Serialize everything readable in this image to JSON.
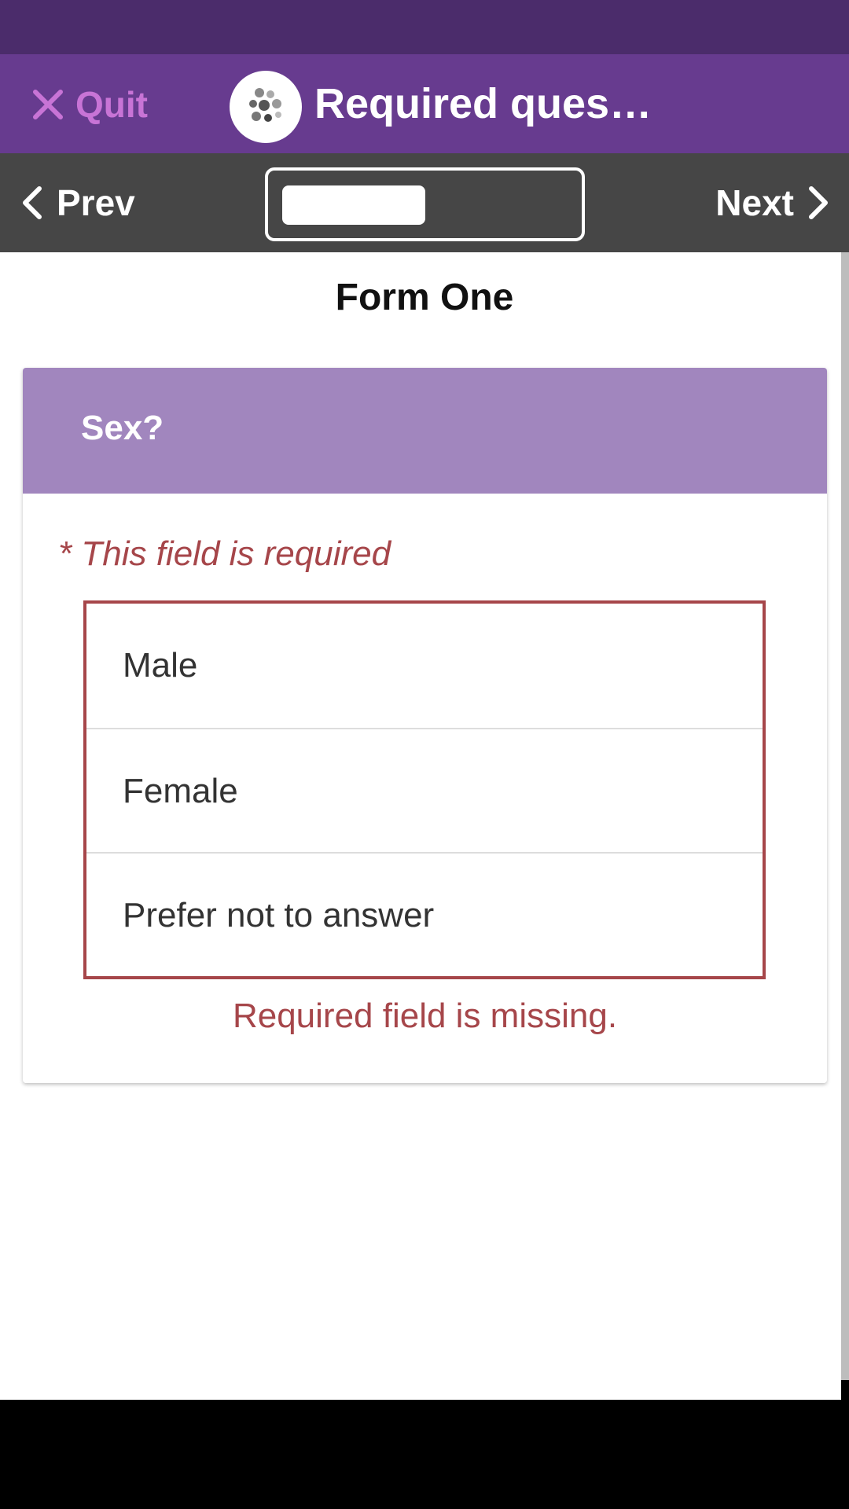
{
  "app_bar": {
    "quit_label": "Quit",
    "title": "Required ques…",
    "logo_icon": "app-logo-icon",
    "color": "#673b8f",
    "accent": "#c874d6"
  },
  "nav": {
    "prev_label": "Prev",
    "next_label": "Next",
    "progress": 0.5
  },
  "form": {
    "title": "Form One",
    "question": {
      "label": "Sex?",
      "required_note": "* This field is required",
      "options": [
        {
          "label": "Male"
        },
        {
          "label": "Female"
        },
        {
          "label": "Prefer not to answer"
        }
      ],
      "error_message": "Required field is missing."
    }
  },
  "colors": {
    "status_bar": "#4b2c6b",
    "nav_bar": "#464646",
    "question_header": "#a186be",
    "error": "#a6464a"
  }
}
